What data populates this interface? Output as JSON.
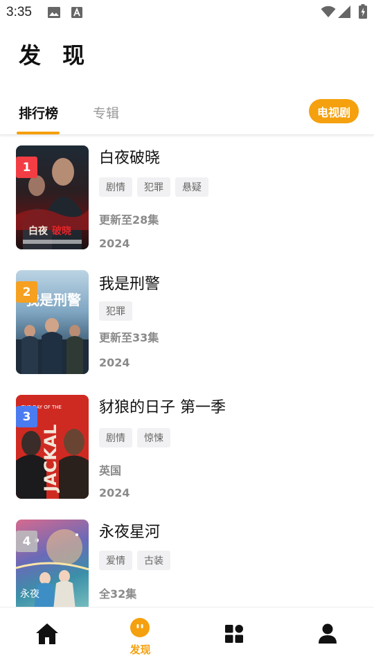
{
  "status_bar": {
    "time": "3:35",
    "icons": [
      "image-icon",
      "font-a-icon",
      "wifi-icon",
      "signal-icon",
      "battery-icon"
    ]
  },
  "page_title": "发 现",
  "tabs": [
    {
      "label": "排行榜",
      "active": true
    },
    {
      "label": "专辑",
      "active": false
    }
  ],
  "category_chip": "电视剧",
  "colors": {
    "accent": "#f5a00e",
    "rank1": "#f23d44",
    "rank2": "#f5a020",
    "rank3": "#4b7bf0",
    "rank4": "#c7c7c7"
  },
  "shows": [
    {
      "rank": "1",
      "title": "白夜破晓",
      "tags": [
        "剧情",
        "犯罪",
        "悬疑"
      ],
      "status": "更新至28集",
      "year": "2024",
      "rank_color": "#f23d44"
    },
    {
      "rank": "2",
      "title": "我是刑警",
      "tags": [
        "犯罪"
      ],
      "status": "更新至33集",
      "year": "2024",
      "rank_color": "#f5a020"
    },
    {
      "rank": "3",
      "title": "豺狼的日子 第一季",
      "tags": [
        "剧情",
        "惊悚"
      ],
      "status": "英国",
      "year": "2024",
      "rank_color": "#4b7bf0"
    },
    {
      "rank": "4",
      "title": "永夜星河",
      "tags": [
        "爱情",
        "古装"
      ],
      "status": "全32集",
      "year": "",
      "rank_color": "#c7c7c7"
    }
  ],
  "bottom_nav": [
    {
      "icon": "home-icon",
      "label": ""
    },
    {
      "icon": "discover-icon",
      "label": "发现",
      "active": true
    },
    {
      "icon": "grid-icon",
      "label": ""
    },
    {
      "icon": "user-icon",
      "label": ""
    }
  ]
}
